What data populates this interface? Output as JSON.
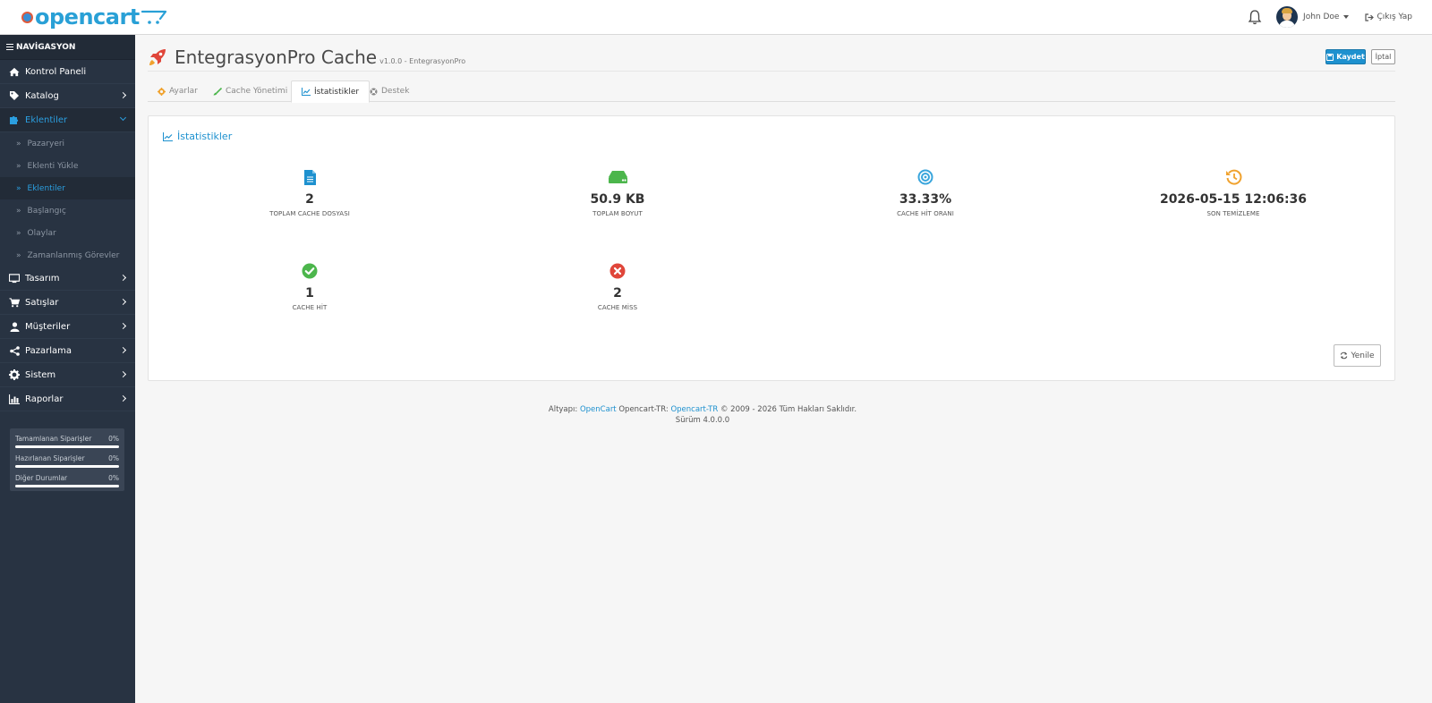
{
  "header": {
    "logo_text": "opencart",
    "user_name": "John Doe",
    "logout_label": "Çıkış Yap"
  },
  "sidebar": {
    "title": "NAVİGASYON",
    "items": [
      {
        "label": "Kontrol Paneli",
        "icon": "home-icon"
      },
      {
        "label": "Katalog",
        "icon": "tag-icon"
      },
      {
        "label": "Eklentiler",
        "icon": "puzzle-icon"
      },
      {
        "label": "Tasarım",
        "icon": "monitor-icon"
      },
      {
        "label": "Satışlar",
        "icon": "cart-icon"
      },
      {
        "label": "Müşteriler",
        "icon": "user-icon"
      },
      {
        "label": "Pazarlama",
        "icon": "share-icon"
      },
      {
        "label": "Sistem",
        "icon": "gear-icon"
      },
      {
        "label": "Raporlar",
        "icon": "bar-chart-icon"
      }
    ],
    "sub_items": [
      {
        "label": "Pazaryeri"
      },
      {
        "label": "Eklenti Yükle"
      },
      {
        "label": "Eklentiler"
      },
      {
        "label": "Başlangıç"
      },
      {
        "label": "Olaylar"
      },
      {
        "label": "Zamanlanmış Görevler"
      }
    ],
    "progress": [
      {
        "label": "Tamamlanan Siparişler",
        "value": "0%",
        "fraction": 0
      },
      {
        "label": "Hazırlanan Siparişler",
        "value": "0%",
        "fraction": 0
      },
      {
        "label": "Diğer Durumlar",
        "value": "0%",
        "fraction": 0
      }
    ]
  },
  "page": {
    "title": "EntegrasyonPro Cache",
    "subtitle": "v1.0.0 - EntegrasyonPro",
    "save_label": "Kaydet",
    "cancel_label": "İptal"
  },
  "tabs": [
    {
      "label": "Ayarlar",
      "icon": "gear-icon"
    },
    {
      "label": "Cache Yönetimi",
      "icon": "brush-icon"
    },
    {
      "label": "İstatistikler",
      "icon": "line-chart-icon"
    },
    {
      "label": "Destek",
      "icon": "support-icon"
    }
  ],
  "panel": {
    "title": "İstatistikler",
    "refresh_label": "Yenile",
    "stats": [
      {
        "value": "2",
        "label": "TOPLAM CACHE DOSYASI",
        "icon": "file-icon",
        "color": "#1e91cf"
      },
      {
        "value": "50.9 KB",
        "label": "TOPLAM BOYUT",
        "icon": "hard-drive-icon",
        "color": "#4cb64c"
      },
      {
        "value": "33.33%",
        "label": "CACHE HİT ORANI",
        "icon": "target-icon",
        "color": "#39a5dc"
      },
      {
        "value": "2026-05-15 12:06:36",
        "label": "SON TEMİZLEME",
        "icon": "history-icon",
        "color": "#f0a22e"
      },
      {
        "value": "1",
        "label": "CACHE HİT",
        "icon": "check-circle-icon",
        "color": "#4cb64c"
      },
      {
        "value": "2",
        "label": "CACHE MİSS",
        "icon": "x-circle-icon",
        "color": "#e0463a"
      }
    ]
  },
  "footer": {
    "prefix": "Altyapı:",
    "link1": "OpenCart",
    "middle": "Opencart-TR:",
    "link2": "Opencart-TR",
    "suffix": "© 2009 - 2026 Tüm Hakları Saklıdır.",
    "version": "Sürüm 4.0.0.0"
  },
  "colors": {
    "accent": "#1e91cf",
    "sidebar_bg": "#283342"
  }
}
